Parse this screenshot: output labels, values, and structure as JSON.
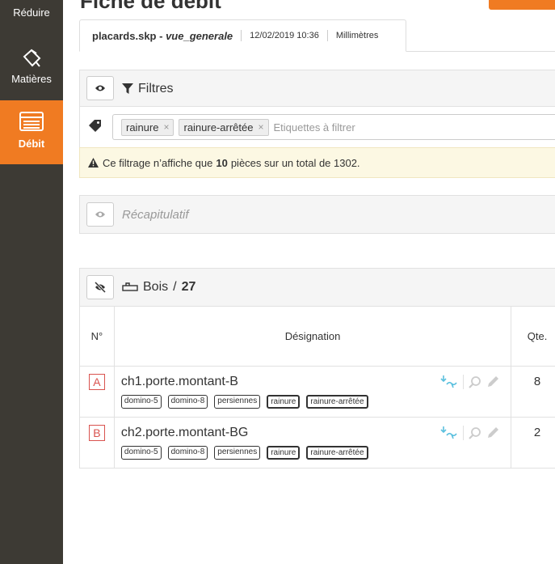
{
  "sidebar": {
    "items": [
      {
        "label": "Réduire",
        "icon": "reduce-icon"
      },
      {
        "label": "Matières",
        "icon": "materials-icon"
      },
      {
        "label": "Débit",
        "icon": "list-icon",
        "active": true
      }
    ],
    "active_color": "#f07b22"
  },
  "header": {
    "title": "Fiche de débit"
  },
  "tab": {
    "file": "placards.skp",
    "view": "vue_generale",
    "separator": " - ",
    "date": "12/02/2019 10:36",
    "unit": "Millimètres"
  },
  "filters": {
    "title": "Filtres",
    "chips": [
      "rainure",
      "rainure-arrêtée"
    ],
    "placeholder": "Etiquettes à filtrer",
    "warning_before": "Ce filtrage n’affiche que",
    "warning_count": "10",
    "warning_after": "pièces sur un total de 1302."
  },
  "recap": {
    "title": "Récapitulatif"
  },
  "bois": {
    "title": "Bois",
    "separator": "/",
    "count": "27",
    "columns": {
      "n": "N°",
      "designation": "Désignation",
      "qte": "Qte."
    },
    "rows": [
      {
        "letter": "A",
        "name": "ch1.porte.montant-B",
        "labels": [
          "domino-5",
          "domino-8",
          "persiennes",
          "rainure",
          "rainure-arrêtée"
        ],
        "qte": "8"
      },
      {
        "letter": "B",
        "name": "ch2.porte.montant-BG",
        "labels": [
          "domino-5",
          "domino-8",
          "persiennes",
          "rainure",
          "rainure-arrêtée"
        ],
        "qte": "2"
      }
    ]
  }
}
